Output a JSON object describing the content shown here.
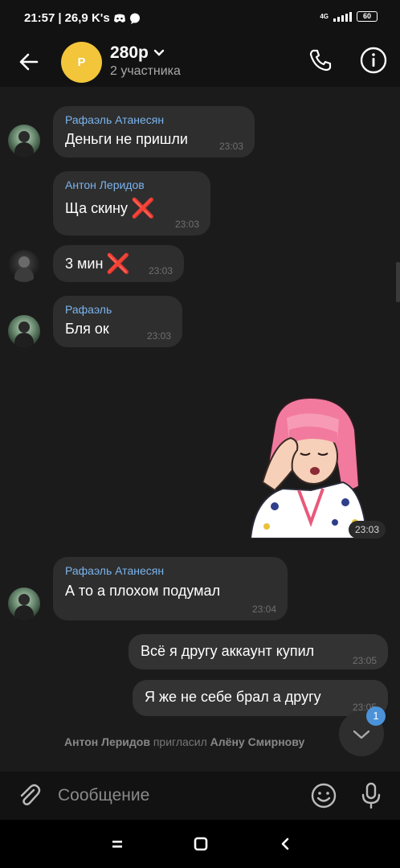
{
  "status_bar": {
    "time": "21:57",
    "separator": "|",
    "speed": "26,9 K's",
    "network": "4G",
    "battery": "60"
  },
  "header": {
    "avatar_letter": "P",
    "title": "280р",
    "subtitle": "2 участника"
  },
  "messages": [
    {
      "sender": "Рафаэль Атанесян",
      "text": "Деньги не пришли",
      "time": "23:03"
    },
    {
      "sender": "Антон Леридов",
      "text": "Ща скину",
      "time": "23:03",
      "emoji": "❌"
    },
    {
      "text": "3 мин",
      "time": "23:03",
      "emoji": "❌"
    },
    {
      "sender": "Рафаэль",
      "text": "Бля ок",
      "time": "23:03"
    },
    {
      "sticker": "sticker-facepalm-girl",
      "time": "23:03"
    },
    {
      "sender": "Рафаэль Атанесян",
      "text": "А то а плохом подумал",
      "time": "23:04"
    },
    {
      "text": "Всё я другу аккаунт купил",
      "time": "23:05"
    },
    {
      "text": "Я же не себе брал а другу",
      "time": "23:05"
    }
  ],
  "service": {
    "actor": "Антон Леридов",
    "action": "пригласил",
    "target": "Алёну Смирнову"
  },
  "scroll_badge": "1",
  "composer": {
    "placeholder": "Сообщение"
  },
  "colors": {
    "accent": "#4b92d8",
    "sender_name": "#7ab4ee",
    "group_avatar": "#f2c53a",
    "bubble": "#2e2e2e",
    "background": "#1b1b1b"
  }
}
